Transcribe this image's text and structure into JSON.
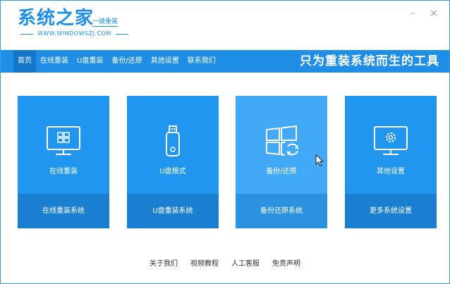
{
  "header": {
    "logo_main": "系统之家",
    "logo_sub": "一键重装",
    "logo_url": "WWW.WINDOWSZJ.COM"
  },
  "window_controls": {
    "minimize": "–",
    "close": "×"
  },
  "nav": {
    "items": [
      {
        "label": "首页"
      },
      {
        "label": "在线重装"
      },
      {
        "label": "U盘重装"
      },
      {
        "label": "备份/还原"
      },
      {
        "label": "其他设置"
      },
      {
        "label": "联系我们"
      }
    ],
    "active_index": 0,
    "slogan": "只为重装系统而生的工具"
  },
  "cards": [
    {
      "title": "在线重装",
      "action": "在线重装系统",
      "icon": "monitor-windows-icon"
    },
    {
      "title": "U盘模式",
      "action": "U盘重装系统",
      "icon": "usb-drive-icon"
    },
    {
      "title": "备份/还原",
      "action": "备份还原系统",
      "icon": "windows-restore-icon"
    },
    {
      "title": "其他设置",
      "action": "更多系统设置",
      "icon": "monitor-gear-icon"
    }
  ],
  "hovered_card_index": 2,
  "footer": {
    "links": [
      "关于我们",
      "视频教程",
      "人工客服",
      "免责声明"
    ]
  },
  "colors": {
    "brand": "#1e8ee6",
    "card": "#2196ee",
    "card_hover": "#41a9f5",
    "card_bottom": "#1a7fd0",
    "nav_active": "#1377c9"
  }
}
